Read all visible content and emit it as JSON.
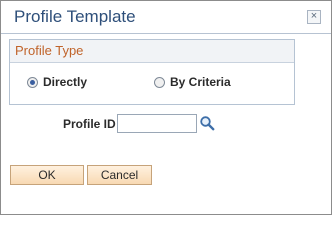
{
  "dialog": {
    "title": "Profile Template",
    "close_symbol": "×"
  },
  "profile_type": {
    "header": "Profile Type",
    "options": [
      {
        "label": "Directly",
        "selected": true
      },
      {
        "label": "By Criteria",
        "selected": false
      }
    ]
  },
  "profile_id": {
    "label": "Profile ID",
    "value": "",
    "lookup_icon": "magnifier-icon"
  },
  "buttons": {
    "ok_label": "OK",
    "cancel_label": "Cancel"
  },
  "colors": {
    "title_text": "#2e4f7a",
    "group_title_text": "#c0632a",
    "button_fill": "#f8d9b3",
    "radio_dot": "#3b5fa0"
  }
}
